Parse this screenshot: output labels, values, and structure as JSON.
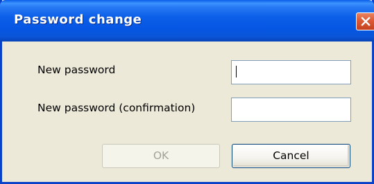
{
  "window": {
    "title": "Password change",
    "close_label": "Close"
  },
  "form": {
    "new_password_label": "New password",
    "new_password_value": "",
    "confirm_password_label": "New password (confirmation)",
    "confirm_password_value": ""
  },
  "buttons": {
    "ok_label": "OK",
    "ok_enabled": false,
    "cancel_label": "Cancel"
  },
  "colors": {
    "titlebar": "#0656e3",
    "dialog_background": "#ece9d8",
    "close_button": "#dc5a35"
  },
  "icons": {
    "close": "close-icon"
  }
}
